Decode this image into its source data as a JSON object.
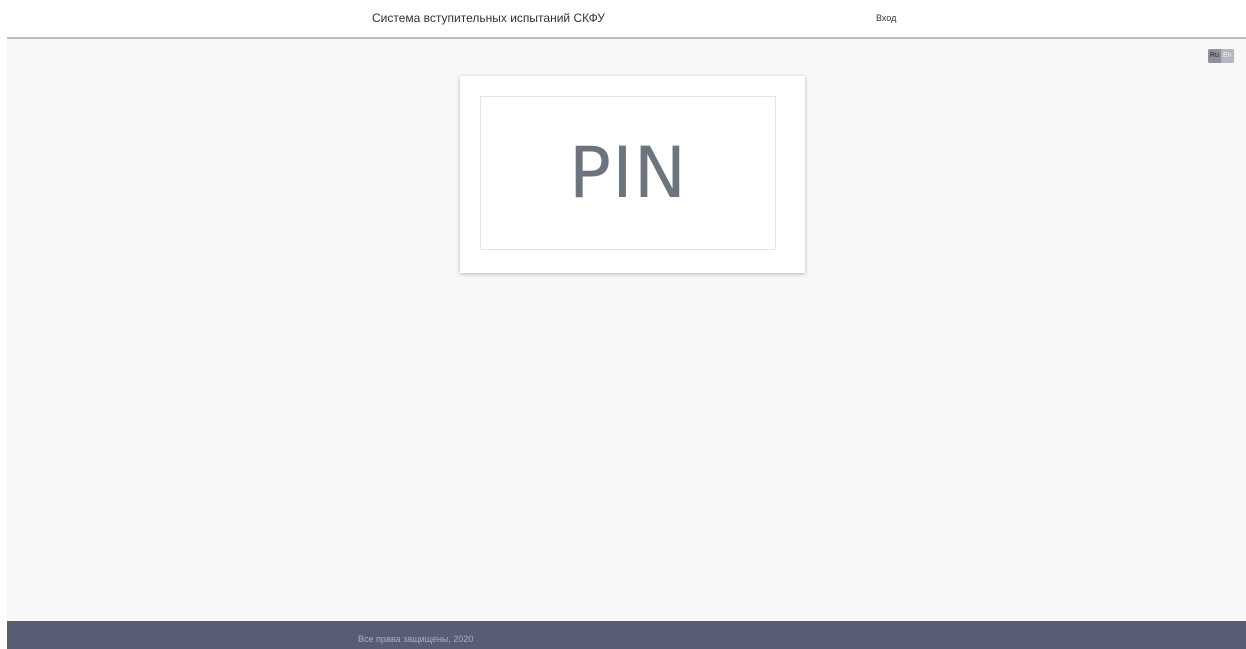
{
  "header": {
    "title": "Система вступительных испытаний СКФУ",
    "login_label": "Вход"
  },
  "language_switch": {
    "options": [
      {
        "label": "Ru",
        "active": true
      },
      {
        "label": "En",
        "active": false
      }
    ]
  },
  "pin_card": {
    "placeholder": "PIN"
  },
  "footer": {
    "copyright": "Все права защищены, 2020"
  },
  "colors": {
    "footer_bg": "#585d73",
    "page_bg": "#f8f8f8",
    "pin_text": "#6c757d"
  }
}
